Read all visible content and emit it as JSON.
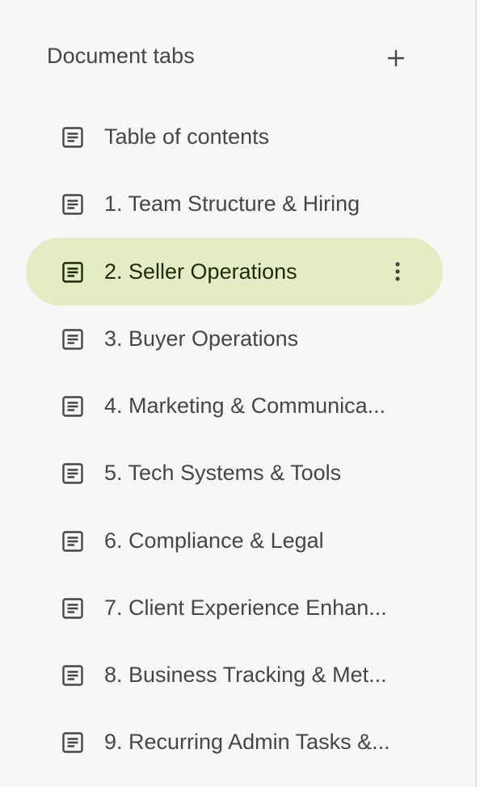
{
  "panel": {
    "title": "Document tabs",
    "add_icon": "plus-icon"
  },
  "colors": {
    "selected_background": "#e4ecc6",
    "panel_background": "#f7f7f5",
    "text": "#444746"
  },
  "tabs": [
    {
      "label": "Table of contents",
      "icon": "document-icon",
      "selected": false
    },
    {
      "label": "1. Team Structure & Hiring",
      "icon": "document-icon",
      "selected": false
    },
    {
      "label": "2. Seller Operations",
      "icon": "document-icon",
      "selected": true,
      "more_icon": "more-vert-icon"
    },
    {
      "label": "3. Buyer Operations",
      "icon": "document-icon",
      "selected": false
    },
    {
      "label": "4. Marketing & Communica...",
      "icon": "document-icon",
      "selected": false
    },
    {
      "label": "5. Tech Systems & Tools",
      "icon": "document-icon",
      "selected": false
    },
    {
      "label": "6. Compliance & Legal",
      "icon": "document-icon",
      "selected": false
    },
    {
      "label": "7. Client Experience Enhan...",
      "icon": "document-icon",
      "selected": false
    },
    {
      "label": "8. Business Tracking & Met...",
      "icon": "document-icon",
      "selected": false
    },
    {
      "label": "9. Recurring Admin Tasks &...",
      "icon": "document-icon",
      "selected": false
    }
  ]
}
